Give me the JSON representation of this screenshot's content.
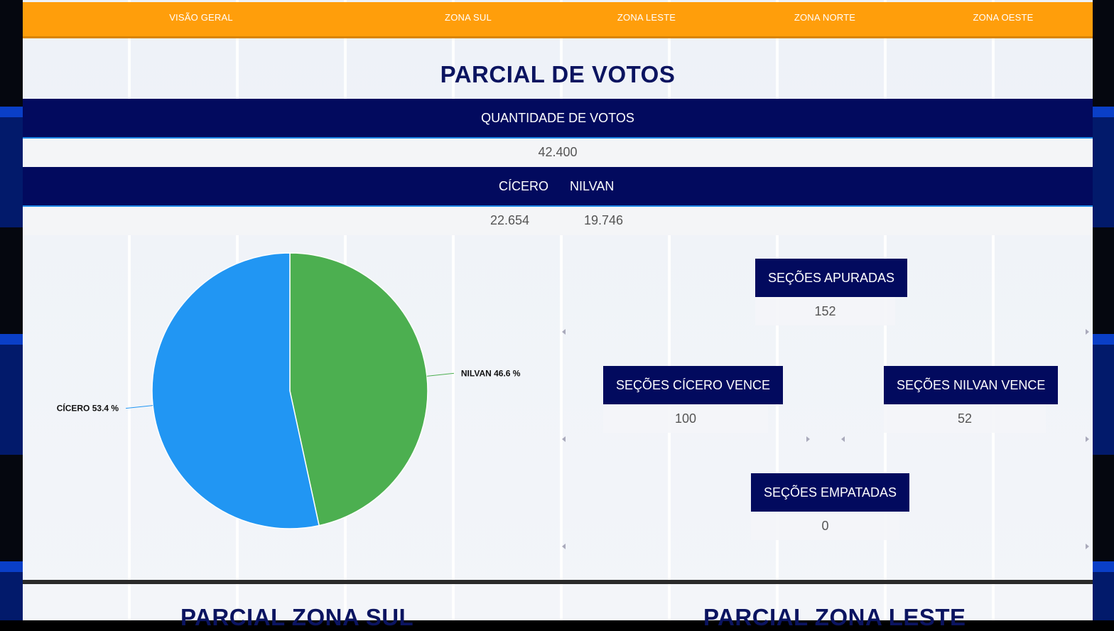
{
  "nav": {
    "items": [
      "VISÃO GERAL",
      "ZONA SUL",
      "ZONA LESTE",
      "ZONA NORTE",
      "ZONA OESTE"
    ]
  },
  "main": {
    "title": "PARCIAL DE VOTOS",
    "total_votes_label": "QUANTIDADE DE VOTOS",
    "total_votes_value": "42.400",
    "candidates": [
      {
        "name": "CÍCERO",
        "votes": "22.654"
      },
      {
        "name": "NILVAN",
        "votes": "19.746"
      }
    ]
  },
  "cards": {
    "apuradas": {
      "label": "SEÇÕES APURADAS",
      "value": "152"
    },
    "cicero_vence": {
      "label": "SEÇÕES CÍCERO VENCE",
      "value": "100"
    },
    "nilvan_vence": {
      "label": "SEÇÕES NILVAN VENCE",
      "value": "52"
    },
    "empatadas": {
      "label": "SEÇÕES EMPATADAS",
      "value": "0"
    }
  },
  "chart_data": {
    "type": "pie",
    "slices": [
      {
        "label": "NILVAN",
        "value": 46.6,
        "color": "#4caf50",
        "display": "NILVAN 46.6 %"
      },
      {
        "label": "CÍCERO",
        "value": 53.4,
        "color": "#2196f3",
        "display": "CÍCERO 53.4 %"
      }
    ]
  },
  "sections": {
    "zona_sul_title": "PARCIAL ZONA SUL",
    "zona_leste_title": "PARCIAL ZONA LESTE"
  },
  "colors": {
    "nav_bg": "#ff9e0b",
    "band_bg": "#020a5e",
    "title": "#0b1460"
  }
}
